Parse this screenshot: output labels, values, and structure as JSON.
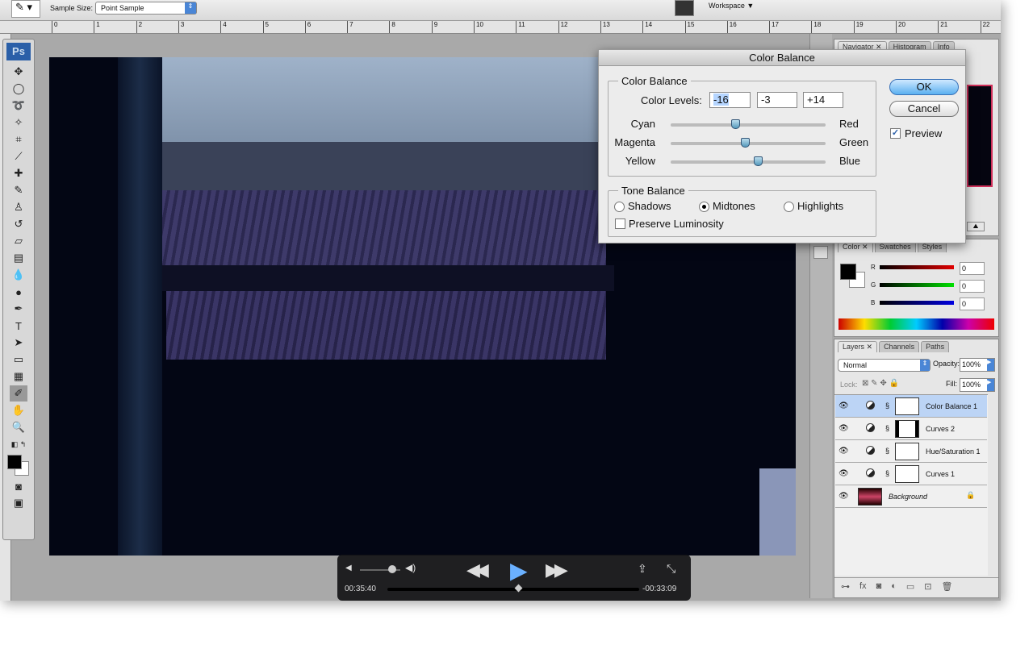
{
  "options_bar": {
    "sample_size_label": "Sample Size:",
    "sample_size_value": "Point Sample",
    "workspace_label": "Workspace ▼"
  },
  "ruler_ticks": [
    "0",
    "1",
    "2",
    "3",
    "4",
    "5",
    "6",
    "7",
    "8",
    "9",
    "10",
    "11",
    "12",
    "13",
    "14",
    "15",
    "16",
    "17",
    "18",
    "19",
    "20",
    "21",
    "22"
  ],
  "toolbox": {
    "logo": "Ps"
  },
  "dialog": {
    "title": "Color Balance",
    "group_color": "Color Balance",
    "color_levels_label": "Color Levels:",
    "levels": [
      "-16",
      "-3",
      "+14"
    ],
    "sliders": [
      {
        "left": "Cyan",
        "right": "Red",
        "value": -16
      },
      {
        "left": "Magenta",
        "right": "Green",
        "value": -3
      },
      {
        "left": "Yellow",
        "right": "Blue",
        "value": 14
      }
    ],
    "group_tone": "Tone Balance",
    "tones": [
      "Shadows",
      "Midtones",
      "Highlights"
    ],
    "selected_tone": "Midtones",
    "preserve_luminosity": "Preserve Luminosity",
    "ok": "OK",
    "cancel": "Cancel",
    "preview": "Preview",
    "preview_checked": true
  },
  "navigator_panel": {
    "tabs": [
      "Navigator",
      "Histogram",
      "Info"
    ]
  },
  "color_panel": {
    "tabs": [
      "Color",
      "Swatches",
      "Styles"
    ],
    "channels": [
      {
        "label": "R",
        "value": "0",
        "color": "#e00000"
      },
      {
        "label": "G",
        "value": "0",
        "color": "#00e000"
      },
      {
        "label": "B",
        "value": "0",
        "color": "#0000e0"
      }
    ]
  },
  "layers_panel": {
    "tabs": [
      "Layers",
      "Channels",
      "Paths"
    ],
    "blend_mode": "Normal",
    "opacity_label": "Opacity:",
    "opacity": "100%",
    "lock_label": "Lock:",
    "fill_label": "Fill:",
    "fill": "100%",
    "layers": [
      {
        "name": "Color Balance 1",
        "selected": true
      },
      {
        "name": "Curves 2"
      },
      {
        "name": "Hue/Saturation 1"
      },
      {
        "name": "Curves 1"
      },
      {
        "name": "Background"
      }
    ]
  },
  "video": {
    "elapsed": "00:35:40",
    "remaining": "-00:33:09",
    "progress": 0.52,
    "volume": 0.8
  }
}
